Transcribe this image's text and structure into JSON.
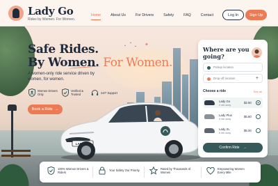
{
  "brand": {
    "name": "Lady Go",
    "tagline": "Rides by Women. For Women."
  },
  "nav": {
    "links": [
      {
        "label": "Home",
        "active": true
      },
      {
        "label": "About Us",
        "active": false
      },
      {
        "label": "For Drivers",
        "active": false
      },
      {
        "label": "Safety",
        "active": false
      },
      {
        "label": "FAQ",
        "active": false
      },
      {
        "label": "Contact",
        "active": false
      }
    ],
    "login_label": "Log In",
    "signup_label": "Sign Up"
  },
  "hero": {
    "title_line1": "Safe Rides.",
    "title_line2a": "By Women.",
    "title_line2b": "For Women.",
    "subtitle": "A women-only ride service driven by women, for women.",
    "features": [
      {
        "icon": "shield-user-icon",
        "label": "Women Drivers Only"
      },
      {
        "icon": "shield-check-icon",
        "label": "Verified & Trusted"
      },
      {
        "icon": "headset-icon",
        "label": "24/7 Support"
      }
    ],
    "book_label": "Book a Ride",
    "plate": "LADY GO"
  },
  "panel": {
    "title": "Where are you going?",
    "pickup_placeholder": "Pickup location",
    "dropoff_placeholder": "Drop-off location",
    "choose_label": "Choose a ride",
    "see_all": "See all",
    "rides": [
      {
        "name": "Lady Go",
        "eta": "4 min away",
        "price": "$2.50",
        "selected": true,
        "color": "#2f3a45"
      },
      {
        "name": "Lady Plus",
        "eta": "6 min away",
        "price": "$5.80",
        "selected": false,
        "color": "#8a9297"
      },
      {
        "name": "Lady XL",
        "eta": "8 min away",
        "price": "$5.00",
        "selected": false,
        "color": "#5d6670"
      }
    ],
    "confirm_label": "Confirm Ride"
  },
  "bottom": [
    {
      "icon": "shield-check-icon",
      "text": "100% Women Drivers & Riders"
    },
    {
      "icon": "lock-icon",
      "text": "Your Safety Our Priority"
    },
    {
      "icon": "star-icon",
      "text": "Rated by Thousands of Women"
    },
    {
      "icon": "heart-icon",
      "text": "Empowering Women Every Mile"
    }
  ],
  "colors": {
    "accent": "#ec7b55",
    "dark": "#1f2a3a",
    "teal": "#36595a"
  }
}
